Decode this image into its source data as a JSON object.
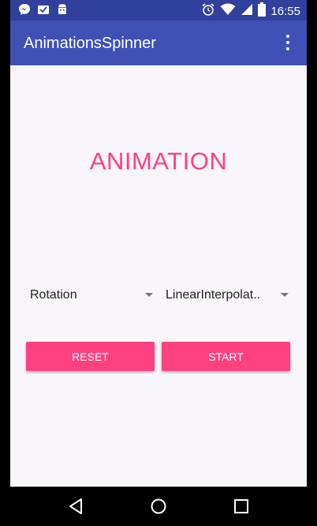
{
  "status_bar": {
    "time": "16:55",
    "icons_left": [
      "messenger-icon",
      "mail-icon",
      "android-icon"
    ],
    "icons_right": [
      "alarm-icon",
      "wifi-icon",
      "signal-icon",
      "battery-icon"
    ]
  },
  "app_bar": {
    "title": "AnimationsSpinner",
    "background": "#3f51b5",
    "status_background": "#30409c"
  },
  "main": {
    "heading": "ANIMATION",
    "accent": "#ff4081",
    "spinner_animation": {
      "selected": "Rotation"
    },
    "spinner_interpolator": {
      "selected": "LinearInterpolat.."
    },
    "reset_label": "RESET",
    "start_label": "START"
  },
  "nav_bar": {
    "buttons": [
      "back-icon",
      "home-icon",
      "recents-icon"
    ]
  }
}
